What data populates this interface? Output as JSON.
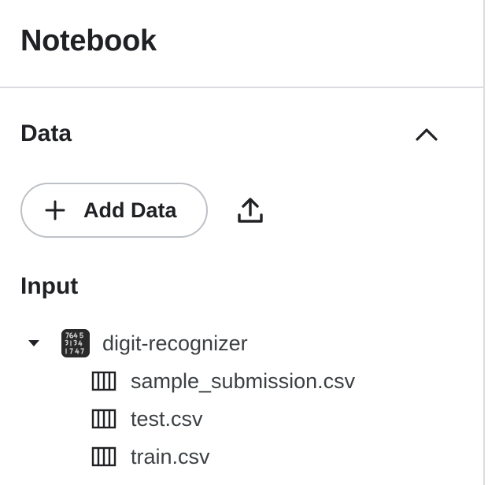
{
  "header": {
    "title": "Notebook"
  },
  "data_section": {
    "title": "Data",
    "collapse_icon": "chevron-up-icon",
    "add_data_label": "Add Data",
    "add_icon": "plus-icon",
    "upload_icon": "upload-icon"
  },
  "input_section": {
    "title": "Input",
    "dataset": {
      "name": "digit-recognizer",
      "expand_icon": "caret-down-icon",
      "files": [
        {
          "name": "sample_submission.csv",
          "icon": "table-icon"
        },
        {
          "name": "test.csv",
          "icon": "table-icon"
        },
        {
          "name": "train.csv",
          "icon": "table-icon"
        }
      ]
    }
  }
}
